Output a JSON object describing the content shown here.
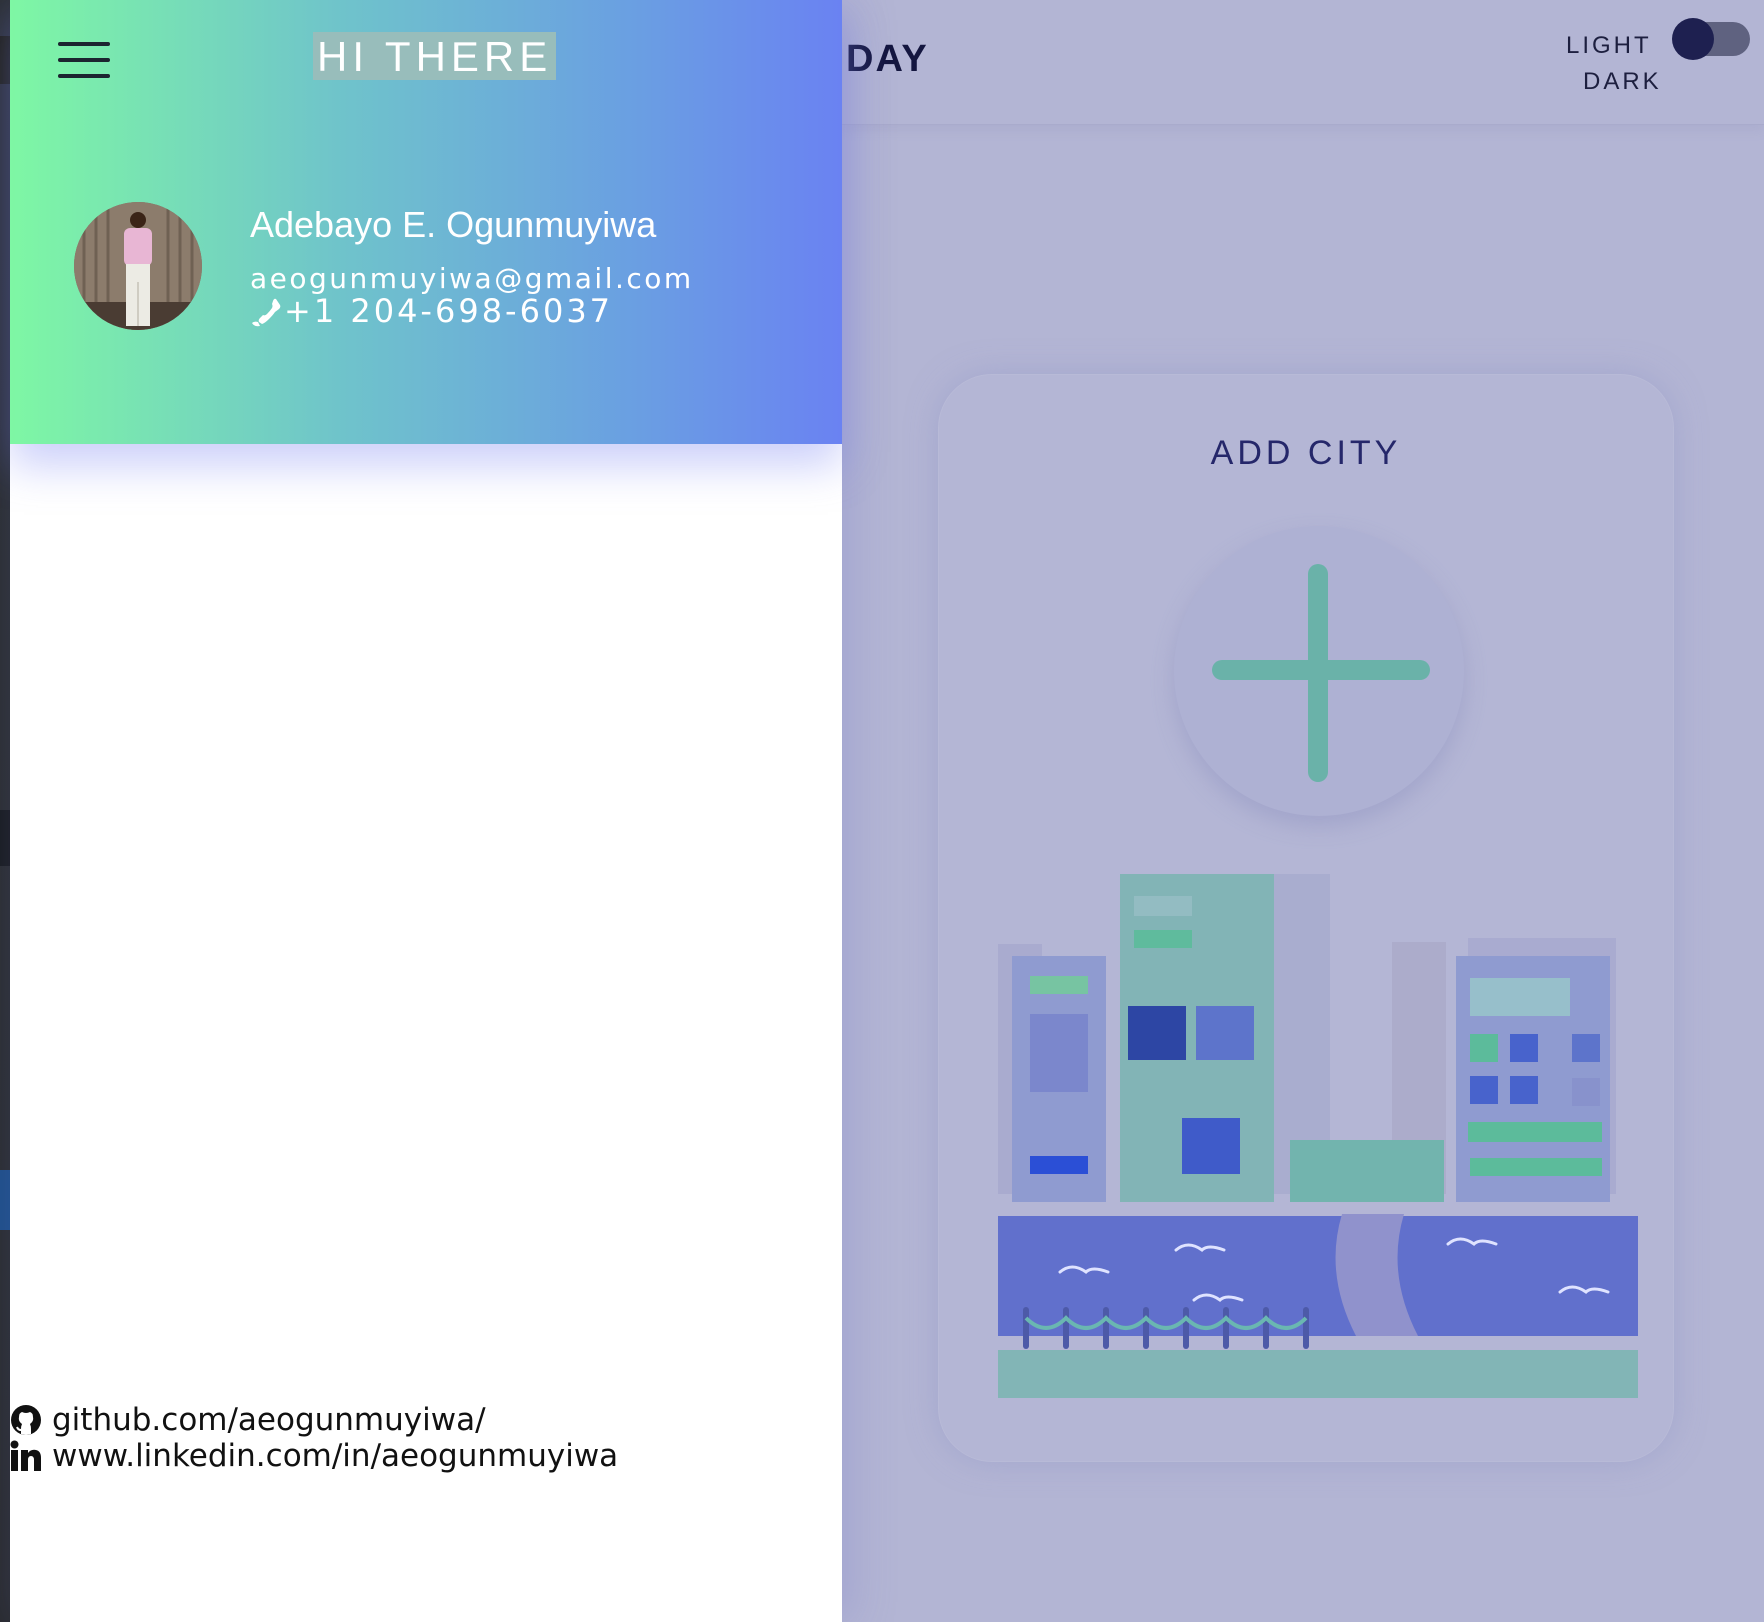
{
  "app": {
    "title_partial": "DAY"
  },
  "theme_toggle": {
    "light_label": "LIGHT",
    "dark_label": "DARK",
    "mode": "dark"
  },
  "card": {
    "title": "ADD CITY"
  },
  "drawer": {
    "greeting": "HI THERE",
    "profile": {
      "name": "Adebayo E. Ogunmuyiwa",
      "email": "aeogunmuyiwa@gmail.com",
      "phone": "+1 204-698-6037"
    },
    "links": {
      "github": "github.com/aeogunmuyiwa/",
      "linkedin": "www.linkedin.com/in/aeogunmuyiwa"
    }
  },
  "icons": {
    "menu": "hamburger-icon",
    "phone": "phone-icon",
    "github": "github-icon",
    "linkedin": "linkedin-icon",
    "add": "plus-icon"
  },
  "colors": {
    "header_gradient_start": "#7ef7a4",
    "header_gradient_end": "#6a82f2",
    "app_background": "#b3b5d4",
    "accent_green": "#6ab2a9",
    "title_navy": "#14163f"
  }
}
